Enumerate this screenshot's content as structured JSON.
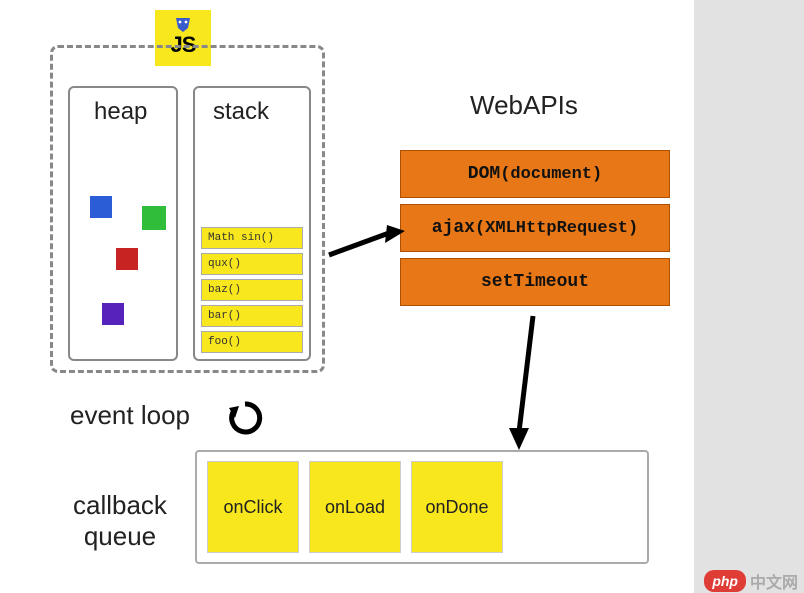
{
  "badge": {
    "text": "JS"
  },
  "runtime": {
    "heap_label": "heap",
    "stack_label": "stack",
    "stack_frames": [
      "Math sin()",
      "qux()",
      "baz()",
      "bar()",
      "foo()"
    ],
    "heap_blocks": {
      "blue": "#2a5dd6",
      "green": "#2fbd3a",
      "red": "#c82323",
      "purple": "#5522bb"
    }
  },
  "webapi": {
    "title": "WebAPIs",
    "items": [
      {
        "prefix": "DOM",
        "detail": "(document)"
      },
      {
        "prefix": "ajax",
        "detail": "(XMLHttpRequest)"
      },
      {
        "prefix": "setTimeout",
        "detail": ""
      }
    ]
  },
  "eventloop": {
    "label": "event loop"
  },
  "callback": {
    "label_line1": "callback",
    "label_line2": "queue",
    "items": [
      "onClick",
      "onLoad",
      "onDone"
    ]
  },
  "watermark": {
    "php": "php",
    "text": "中文网"
  },
  "colors": {
    "yellow": "#f8e71c",
    "orange": "#e87817"
  }
}
